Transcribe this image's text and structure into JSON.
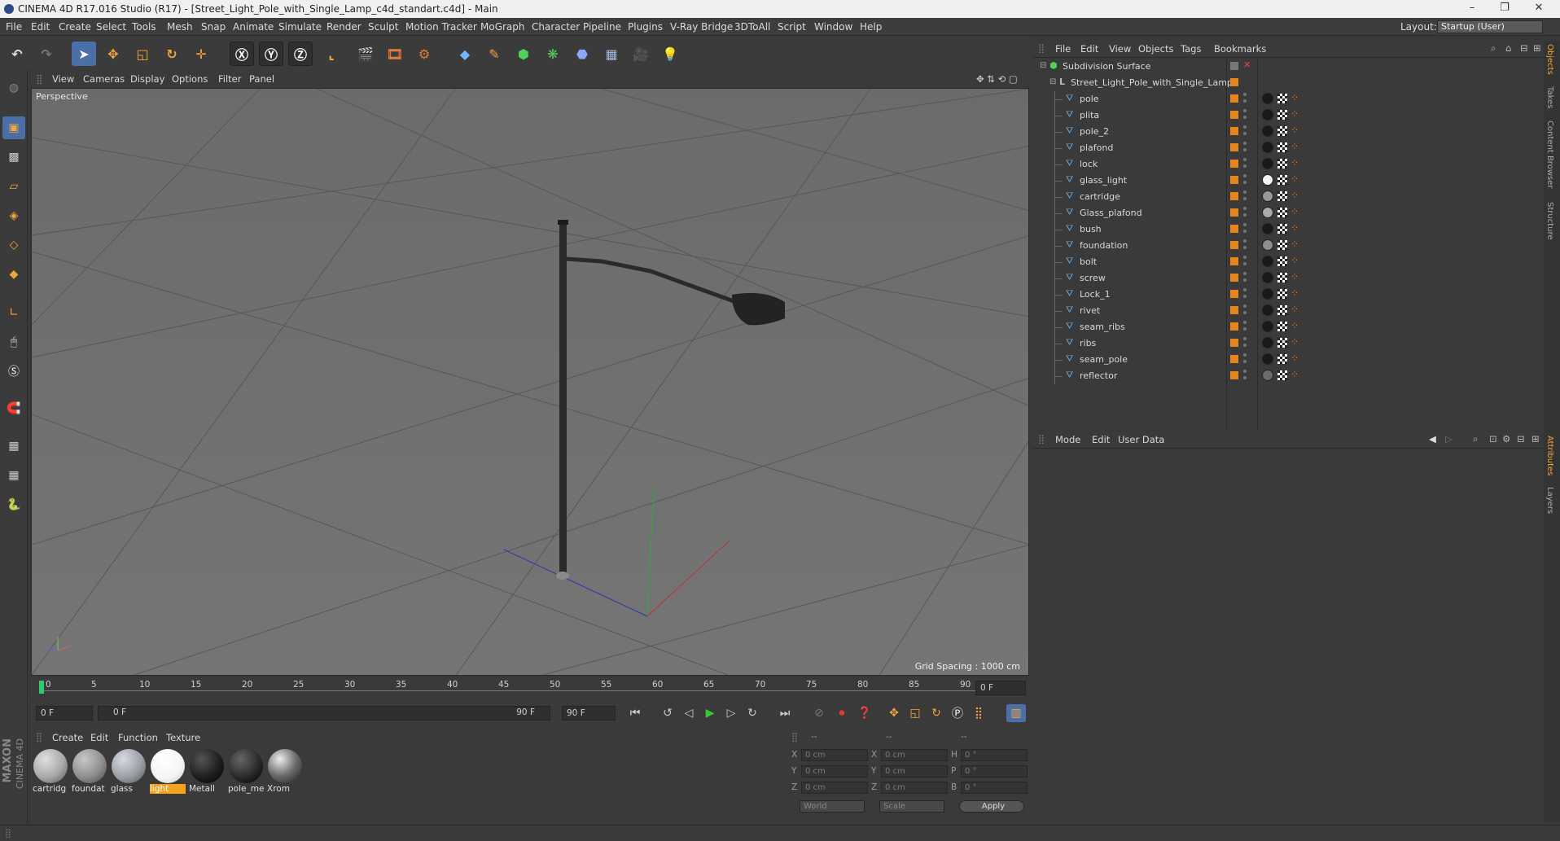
{
  "window": {
    "title": "CINEMA 4D R17.016 Studio (R17) - [Street_Light_Pole_with_Single_Lamp_c4d_standart.c4d] - Main"
  },
  "menu": [
    "File",
    "Edit",
    "Create",
    "Select",
    "Tools",
    "Mesh",
    "Snap",
    "Animate",
    "Simulate",
    "Render",
    "Sculpt",
    "Motion Tracker",
    "MoGraph",
    "Character",
    "Pipeline",
    "Plugins",
    "V-Ray Bridge",
    "3DToAll",
    "Script",
    "Window",
    "Help"
  ],
  "layout": {
    "label": "Layout:",
    "value": "Startup (User)"
  },
  "viewport_menu": [
    "View",
    "Cameras",
    "Display",
    "Options",
    "Filter",
    "Panel"
  ],
  "viewport": {
    "label": "Perspective",
    "grid_spacing": "Grid Spacing : 1000 cm"
  },
  "timeline": {
    "ticks": [
      "0",
      "5",
      "10",
      "15",
      "20",
      "25",
      "30",
      "35",
      "40",
      "45",
      "50",
      "55",
      "60",
      "65",
      "70",
      "75",
      "80",
      "85",
      "90"
    ],
    "current_frame": "0 F"
  },
  "transport": {
    "start": "0 F",
    "range_start": "0 F",
    "range_end": "90 F",
    "end": "90 F"
  },
  "material_menu": [
    "Create",
    "Edit",
    "Function",
    "Texture"
  ],
  "materials": [
    {
      "name": "cartridg",
      "color": "#a9a9a9"
    },
    {
      "name": "foundat",
      "color": "#8e8e8e"
    },
    {
      "name": "glass",
      "color": "#9aa0a6"
    },
    {
      "name": "light",
      "color": "#f4f4f4",
      "selected": true
    },
    {
      "name": "Metall",
      "color": "#1f1f1f"
    },
    {
      "name": "pole_me",
      "color": "#2b2b2b"
    },
    {
      "name": "Xrom",
      "color": "#6c6c6c"
    }
  ],
  "coords": {
    "headers": [
      "--",
      "--",
      "--"
    ],
    "rows": [
      {
        "a": "X",
        "av": "0 cm",
        "b": "X",
        "bv": "0 cm",
        "c": "H",
        "cv": "0 °"
      },
      {
        "a": "Y",
        "av": "0 cm",
        "b": "Y",
        "bv": "0 cm",
        "c": "P",
        "cv": "0 °"
      },
      {
        "a": "Z",
        "av": "0 cm",
        "b": "Z",
        "bv": "0 cm",
        "c": "B",
        "cv": "0 °"
      }
    ],
    "world": "World",
    "scale": "Scale",
    "apply": "Apply"
  },
  "object_menu": [
    "File",
    "Edit",
    "View",
    "Objects",
    "Tags",
    "Bookmarks"
  ],
  "objects": {
    "root": "Subdivision Surface",
    "group": "Street_Light_Pole_with_Single_Lamp",
    "children": [
      "pole",
      "plita",
      "pole_2",
      "plafond",
      "lock",
      "glass_light",
      "cartridge",
      "Glass_plafond",
      "bush",
      "foundation",
      "bolt",
      "screw",
      "Lock_1",
      "rivet",
      "seam_ribs",
      "ribs",
      "seam_pole",
      "reflector"
    ],
    "tag_colors": [
      "#1a1a1a",
      "#1a1a1a",
      "#1a1a1a",
      "#1a1a1a",
      "#1a1a1a",
      "#f4f4f4",
      "#999",
      "#aaa",
      "#1a1a1a",
      "#8e8e8e",
      "#1a1a1a",
      "#1a1a1a",
      "#1a1a1a",
      "#1a1a1a",
      "#1a1a1a",
      "#1a1a1a",
      "#1a1a1a",
      "#6c6c6c"
    ]
  },
  "attr_menu": [
    "Mode",
    "Edit",
    "User Data"
  ],
  "right_tabs": [
    "Objects",
    "Takes",
    "Content Browser",
    "Structure",
    "Attributes",
    "Layers"
  ],
  "brand": {
    "line1": "MAXON",
    "line2": "CINEMA 4D"
  },
  "colors": {
    "accent": "#e8841f",
    "selected": "#f7a21b",
    "blue": "#4b6fa8"
  }
}
